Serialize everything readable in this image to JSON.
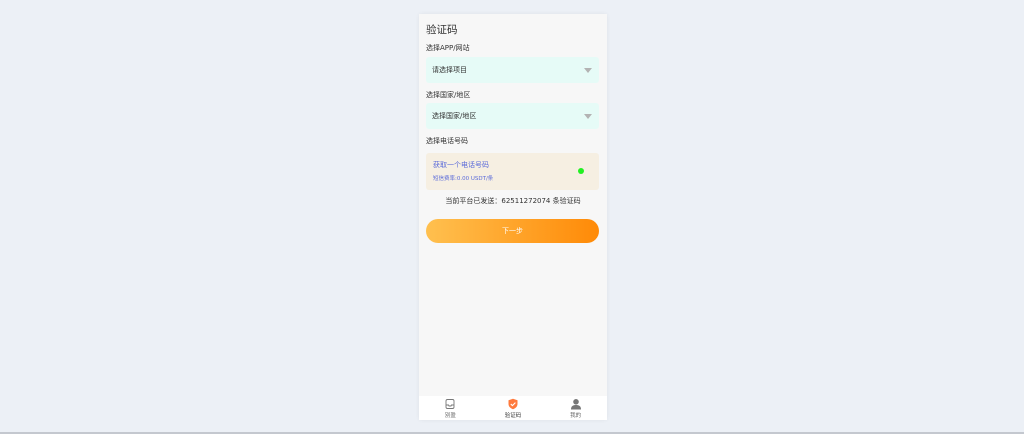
{
  "page": {
    "title": "验证码"
  },
  "app_select": {
    "label": "选择APP/网站",
    "value": "请选择项目"
  },
  "country_select": {
    "label": "选择国家/地区",
    "value": "选择国家/地区"
  },
  "phone": {
    "label": "选择电话号码",
    "get_text": "获取一个电话号码",
    "rate_text": "短信费率:0.00 USDT/条",
    "status_color": "#22f022"
  },
  "stats": {
    "text": "当前平台已发送：62511272074 条验证码"
  },
  "next_button": {
    "label": "下一步"
  },
  "tabbar": {
    "items": [
      {
        "label": "別盈",
        "icon": "inbox-icon"
      },
      {
        "label": "验证码",
        "icon": "shield-check-icon",
        "active": true,
        "color": "#ff7a3d"
      },
      {
        "label": "我的",
        "icon": "user-icon"
      }
    ]
  }
}
